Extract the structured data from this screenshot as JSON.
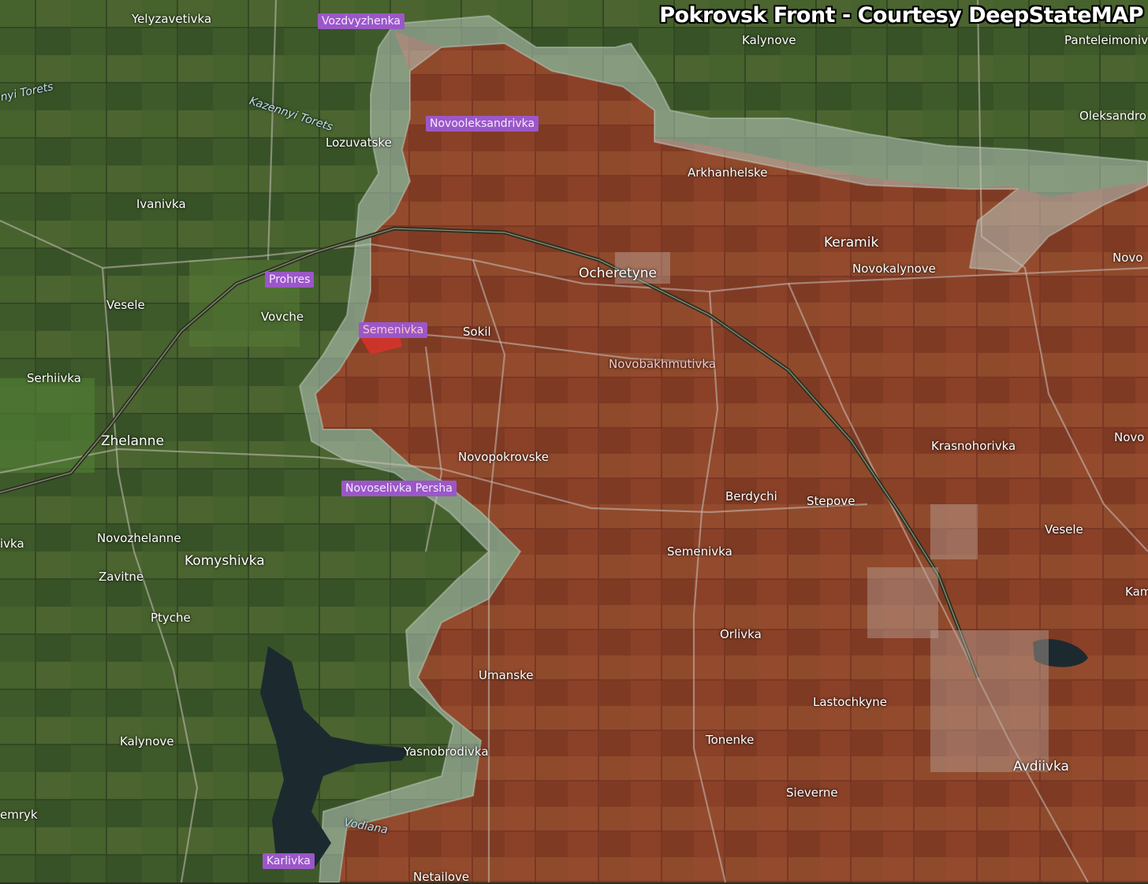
{
  "title": "Pokrovsk Front - Courtesy DeepStateMAP",
  "colors": {
    "terrain_green": "#3f5a2a",
    "field_light": "#5a6b36",
    "occupied_red": "#8a3f28",
    "contested_gray": "#b9c9bf",
    "road": "#c9c0b8",
    "highway": "#2e3a24",
    "water": "#1c2a30",
    "highlight_purple": "#9b57c8"
  },
  "labels": [
    {
      "id": "yelyzavetivka",
      "text": "Yelyzavetivka"
    },
    {
      "id": "vozdvyzhenka",
      "text": "Vozdvyzhenka"
    },
    {
      "id": "kalynove-north",
      "text": "Kalynove"
    },
    {
      "id": "panteleimonivka",
      "text": "Panteleimonivk"
    },
    {
      "id": "toretsk-river-west",
      "text": "nyi Torets"
    },
    {
      "id": "kazennyi-torets",
      "text": "Kazennyi Torets"
    },
    {
      "id": "novooleksandrivka",
      "text": "Novooleksandrivka"
    },
    {
      "id": "oleksandropil",
      "text": "Oleksandro"
    },
    {
      "id": "lozuvatske",
      "text": "Lozuvatske"
    },
    {
      "id": "arkhanhelske",
      "text": "Arkhanhelske"
    },
    {
      "id": "ivanivka",
      "text": "Ivanivka"
    },
    {
      "id": "keramik",
      "text": "Keramik"
    },
    {
      "id": "novokalynove",
      "text": "Novokalynove"
    },
    {
      "id": "ocheretyne",
      "text": "Ocheretyne"
    },
    {
      "id": "novo-east",
      "text": "Novo"
    },
    {
      "id": "prohres",
      "text": "Prohres"
    },
    {
      "id": "vesele-west",
      "text": "Vesele"
    },
    {
      "id": "vovche",
      "text": "Vovche"
    },
    {
      "id": "semenivka-north",
      "text": "Semenivka"
    },
    {
      "id": "sokil",
      "text": "Sokil"
    },
    {
      "id": "novobakhmutivka",
      "text": "Novobakhmutivka"
    },
    {
      "id": "serhiivka",
      "text": "Serhiivka"
    },
    {
      "id": "zhelanne",
      "text": "Zhelanne"
    },
    {
      "id": "krasnohorivka",
      "text": "Krasnohorivka"
    },
    {
      "id": "novo-east-2",
      "text": "Novo"
    },
    {
      "id": "novopokrovske",
      "text": "Novopokrovske"
    },
    {
      "id": "novoselivka-persha",
      "text": "Novoselivka Persha"
    },
    {
      "id": "berdychi",
      "text": "Berdychi"
    },
    {
      "id": "stepove",
      "text": "Stepove"
    },
    {
      "id": "vesele-east",
      "text": "Vesele"
    },
    {
      "id": "ivka-west",
      "text": "ivka"
    },
    {
      "id": "novozhelanne",
      "text": "Novozhelanne"
    },
    {
      "id": "komyshivka",
      "text": "Komyshivka"
    },
    {
      "id": "semenivka",
      "text": "Semenivka"
    },
    {
      "id": "zavitne",
      "text": "Zavitne"
    },
    {
      "id": "kam-east",
      "text": "Kam"
    },
    {
      "id": "ptyche",
      "text": "Ptyche"
    },
    {
      "id": "orlivka",
      "text": "Orlivka"
    },
    {
      "id": "umanske",
      "text": "Umanske"
    },
    {
      "id": "lastochkyne",
      "text": "Lastochkyne"
    },
    {
      "id": "kalynove-south",
      "text": "Kalynove"
    },
    {
      "id": "tonenke",
      "text": "Tonenke"
    },
    {
      "id": "yasnobrodivka",
      "text": "Yasnobrodivka"
    },
    {
      "id": "avdiivka",
      "text": "Avdiivka"
    },
    {
      "id": "sieverne",
      "text": "Sieverne"
    },
    {
      "id": "emryk",
      "text": "emryk"
    },
    {
      "id": "vodiana",
      "text": "Vodiana"
    },
    {
      "id": "karlivka",
      "text": "Karlivka"
    },
    {
      "id": "netailove",
      "text": "Netailove"
    }
  ]
}
